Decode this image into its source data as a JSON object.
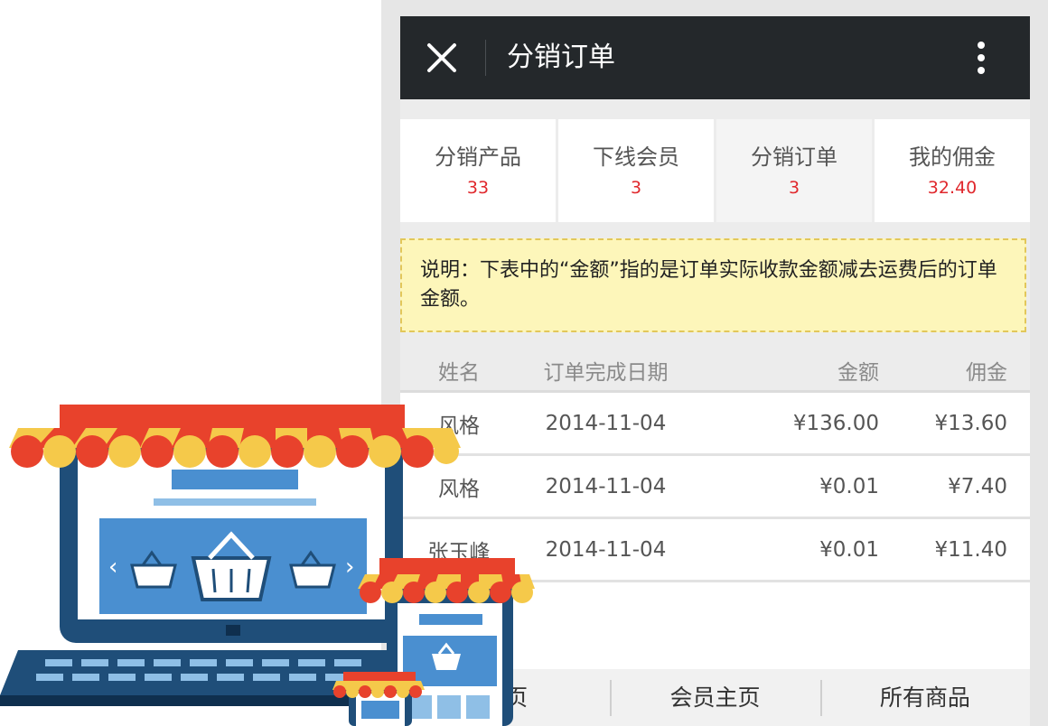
{
  "titlebar": {
    "title": "分销订单",
    "close_icon": "close-icon",
    "more_icon": "more-vertical-icon"
  },
  "stats": [
    {
      "label": "分销产品",
      "value": "33"
    },
    {
      "label": "下线会员",
      "value": "3"
    },
    {
      "label": "分销订单",
      "value": "3"
    },
    {
      "label": "我的佣金",
      "value": "32.40"
    }
  ],
  "notice": {
    "text": "说明：下表中的“金额”指的是订单实际收款金额减去运费后的订单金额。"
  },
  "table": {
    "headers": [
      "姓名",
      "订单完成日期",
      "金额",
      "佣金"
    ],
    "rows": [
      [
        "风格",
        "2014-11-04",
        "¥136.00",
        "¥13.60"
      ],
      [
        "风格",
        "2014-11-04",
        "¥0.01",
        "¥7.40"
      ],
      [
        "张玉峰",
        "2014-11-04",
        "¥0.01",
        "¥11.40"
      ]
    ]
  },
  "bottom_nav": [
    "主页",
    "会员主页",
    "所有商品"
  ],
  "colors": {
    "titlebar_bg": "#24282b",
    "stat_value": "#e0282d",
    "notice_bg": "#fdf6ba",
    "awning_red": "#e8422c",
    "awning_yellow": "#f5c94a",
    "device_blue": "#1f4e79",
    "screen_blue": "#4a8fd0"
  }
}
